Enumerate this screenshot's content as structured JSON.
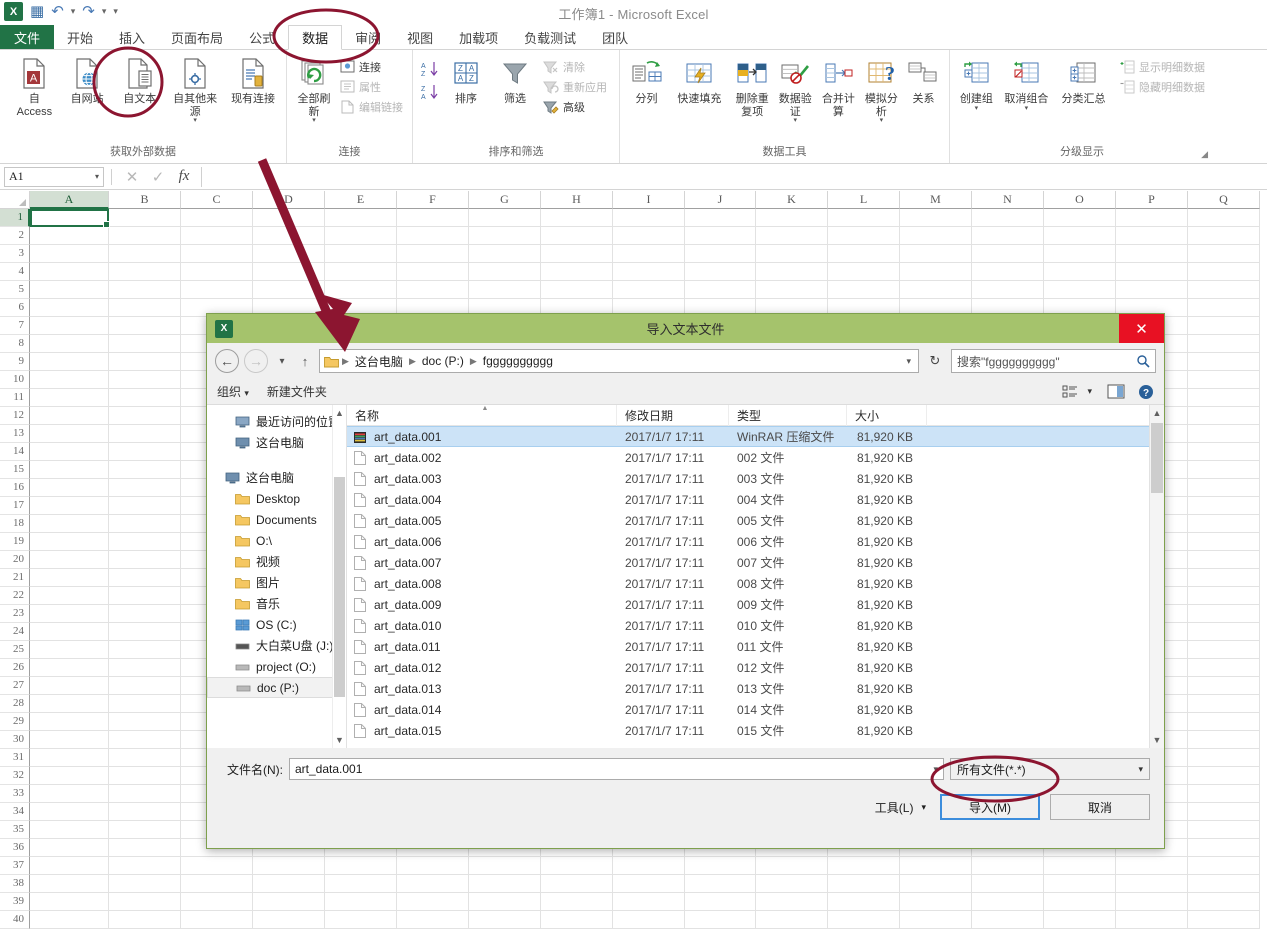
{
  "app": {
    "window_title": "工作簿1 - Microsoft Excel",
    "logo_text": "X",
    "qat": [
      {
        "name": "save",
        "glyph": "▤"
      },
      {
        "name": "undo",
        "glyph": "↶"
      },
      {
        "name": "redo",
        "glyph": "↷"
      },
      {
        "name": "customize",
        "glyph": "▾"
      }
    ]
  },
  "ribbon": {
    "tabs": [
      {
        "label": "文件",
        "kind": "file"
      },
      {
        "label": "开始",
        "kind": "normal"
      },
      {
        "label": "插入",
        "kind": "normal"
      },
      {
        "label": "页面布局",
        "kind": "normal"
      },
      {
        "label": "公式",
        "kind": "normal"
      },
      {
        "label": "数据",
        "kind": "active"
      },
      {
        "label": "审阅",
        "kind": "normal"
      },
      {
        "label": "视图",
        "kind": "normal"
      },
      {
        "label": "加载项",
        "kind": "normal"
      },
      {
        "label": "负载测试",
        "kind": "normal"
      },
      {
        "label": "团队",
        "kind": "normal"
      }
    ],
    "groups": [
      {
        "label": "获取外部数据",
        "big": [
          {
            "label": "自 Access",
            "icon": "from-access-icon"
          },
          {
            "label": "自网站",
            "icon": "from-web-icon"
          },
          {
            "label": "自文本",
            "icon": "from-text-icon"
          },
          {
            "label": "自其他来源",
            "icon": "from-other-sources-icon",
            "caret": true
          },
          {
            "label": "现有连接",
            "icon": "existing-connections-icon"
          }
        ]
      },
      {
        "label": "连接",
        "big": [
          {
            "label": "全部刷新",
            "icon": "refresh-all-icon",
            "caret": true
          }
        ],
        "small": [
          {
            "label": "连接",
            "icon": "connections-icon",
            "dim": false
          },
          {
            "label": "属性",
            "icon": "properties-icon",
            "dim": true
          },
          {
            "label": "编辑链接",
            "icon": "edit-links-icon",
            "dim": true
          }
        ]
      },
      {
        "label": "排序和筛选",
        "big": [
          {
            "label": "排序",
            "icon": "sort-icon"
          },
          {
            "label": "筛选",
            "icon": "filter-icon"
          }
        ],
        "sortmini": [
          {
            "label": "升序",
            "icon": "sort-asc-icon"
          },
          {
            "label": "降序",
            "icon": "sort-desc-icon"
          }
        ],
        "small": [
          {
            "label": "清除",
            "icon": "clear-filter-icon",
            "dim": true
          },
          {
            "label": "重新应用",
            "icon": "reapply-icon",
            "dim": true
          },
          {
            "label": "高级",
            "icon": "advanced-filter-icon",
            "dim": false
          }
        ]
      },
      {
        "label": "数据工具",
        "big": [
          {
            "label": "分列",
            "icon": "text-to-columns-icon"
          },
          {
            "label": "快速填充",
            "icon": "flash-fill-icon"
          },
          {
            "label": "删除重复项",
            "icon": "remove-duplicates-icon"
          },
          {
            "label": "数据验证",
            "icon": "data-validation-icon",
            "caret": true
          },
          {
            "label": "合并计算",
            "icon": "consolidate-icon"
          },
          {
            "label": "模拟分析",
            "icon": "what-if-analysis-icon",
            "caret": true
          },
          {
            "label": "关系",
            "icon": "relationships-icon"
          }
        ]
      },
      {
        "label": "分级显示",
        "dialog_launcher": true,
        "big": [
          {
            "label": "创建组",
            "icon": "group-icon",
            "caret": true
          },
          {
            "label": "取消组合",
            "icon": "ungroup-icon",
            "caret": true
          },
          {
            "label": "分类汇总",
            "icon": "subtotal-icon"
          }
        ],
        "small": [
          {
            "label": "显示明细数据",
            "icon": "show-detail-icon",
            "dim": true
          },
          {
            "label": "隐藏明细数据",
            "icon": "hide-detail-icon",
            "dim": true
          }
        ]
      }
    ]
  },
  "formula_bar": {
    "name_box": "A1",
    "cancel_icon": "cancel-icon",
    "enter_icon": "enter-icon",
    "fx_icon": "insert-function-icon",
    "value": ""
  },
  "grid": {
    "columns": [
      "A",
      "B",
      "C",
      "D",
      "E",
      "F",
      "G",
      "H",
      "I",
      "J",
      "K",
      "L",
      "M",
      "N",
      "O",
      "P",
      "Q"
    ],
    "rows": [
      1,
      2,
      3,
      4,
      5,
      6,
      7,
      8,
      9,
      10,
      11,
      12,
      13,
      14,
      15,
      16,
      17,
      18,
      19,
      20,
      21,
      22,
      23,
      24,
      25,
      26,
      27,
      28,
      29,
      30,
      31,
      32,
      33,
      34,
      35,
      36,
      37,
      38,
      39,
      40
    ],
    "selected_cell": "A1"
  },
  "dialog": {
    "title": "导入文本文件",
    "icon": "excel-icon",
    "close_label": "✕",
    "nav": {
      "back_icon": "back-arrow-icon",
      "forward_icon": "forward-arrow-icon",
      "recent_icon": "recent-dropdown-icon",
      "up_icon": "up-arrow-icon",
      "breadcrumbs": [
        "这台电脑",
        "doc (P:)",
        "fgggggggggg"
      ],
      "refresh_icon": "refresh-icon",
      "search_placeholder": "搜索\"fgggggggggg\"",
      "search_icon": "search-icon"
    },
    "toolbar": {
      "organize": "组织",
      "new_folder": "新建文件夹",
      "view_icon": "view-layout-icon",
      "view_caret": "▾",
      "preview_icon": "preview-pane-icon",
      "help_icon": "help-icon"
    },
    "nav_pane": {
      "top": [
        {
          "label": "最近访问的位置",
          "icon": "recent-places-icon"
        },
        {
          "label": "这台电脑",
          "icon": "this-pc-icon"
        }
      ],
      "tree": [
        {
          "label": "这台电脑",
          "icon": "this-pc-icon",
          "indent": false
        },
        {
          "label": "Desktop",
          "icon": "desktop-folder-icon",
          "indent": true
        },
        {
          "label": "Documents",
          "icon": "documents-folder-icon",
          "indent": true
        },
        {
          "label": "O:\\",
          "icon": "drive-folder-icon",
          "indent": true
        },
        {
          "label": "视频",
          "icon": "videos-folder-icon",
          "indent": true
        },
        {
          "label": "图片",
          "icon": "pictures-folder-icon",
          "indent": true
        },
        {
          "label": "音乐",
          "icon": "music-folder-icon",
          "indent": true
        },
        {
          "label": "OS (C:)",
          "icon": "windows-drive-icon",
          "indent": true
        },
        {
          "label": "大白菜U盘 (J:)",
          "icon": "usb-drive-icon",
          "indent": true
        },
        {
          "label": "project (O:)",
          "icon": "network-drive-icon",
          "indent": true
        },
        {
          "label": "doc (P:)",
          "icon": "network-drive-icon",
          "indent": true,
          "selected": true
        }
      ]
    },
    "file_list": {
      "columns": [
        "名称",
        "修改日期",
        "类型",
        "大小"
      ],
      "sort_column": "名称",
      "rows": [
        {
          "name": "art_data.001",
          "date": "2017/1/7 17:11",
          "type": "WinRAR 压缩文件",
          "size": "81,920 KB",
          "icon": "winrar-icon",
          "selected": true
        },
        {
          "name": "art_data.002",
          "date": "2017/1/7 17:11",
          "type": "002 文件",
          "size": "81,920 KB",
          "icon": "generic-file-icon",
          "selected": false
        },
        {
          "name": "art_data.003",
          "date": "2017/1/7 17:11",
          "type": "003 文件",
          "size": "81,920 KB",
          "icon": "generic-file-icon",
          "selected": false
        },
        {
          "name": "art_data.004",
          "date": "2017/1/7 17:11",
          "type": "004 文件",
          "size": "81,920 KB",
          "icon": "generic-file-icon",
          "selected": false
        },
        {
          "name": "art_data.005",
          "date": "2017/1/7 17:11",
          "type": "005 文件",
          "size": "81,920 KB",
          "icon": "generic-file-icon",
          "selected": false
        },
        {
          "name": "art_data.006",
          "date": "2017/1/7 17:11",
          "type": "006 文件",
          "size": "81,920 KB",
          "icon": "generic-file-icon",
          "selected": false
        },
        {
          "name": "art_data.007",
          "date": "2017/1/7 17:11",
          "type": "007 文件",
          "size": "81,920 KB",
          "icon": "generic-file-icon",
          "selected": false
        },
        {
          "name": "art_data.008",
          "date": "2017/1/7 17:11",
          "type": "008 文件",
          "size": "81,920 KB",
          "icon": "generic-file-icon",
          "selected": false
        },
        {
          "name": "art_data.009",
          "date": "2017/1/7 17:11",
          "type": "009 文件",
          "size": "81,920 KB",
          "icon": "generic-file-icon",
          "selected": false
        },
        {
          "name": "art_data.010",
          "date": "2017/1/7 17:11",
          "type": "010 文件",
          "size": "81,920 KB",
          "icon": "generic-file-icon",
          "selected": false
        },
        {
          "name": "art_data.011",
          "date": "2017/1/7 17:11",
          "type": "011 文件",
          "size": "81,920 KB",
          "icon": "generic-file-icon",
          "selected": false
        },
        {
          "name": "art_data.012",
          "date": "2017/1/7 17:11",
          "type": "012 文件",
          "size": "81,920 KB",
          "icon": "generic-file-icon",
          "selected": false
        },
        {
          "name": "art_data.013",
          "date": "2017/1/7 17:11",
          "type": "013 文件",
          "size": "81,920 KB",
          "icon": "generic-file-icon",
          "selected": false
        },
        {
          "name": "art_data.014",
          "date": "2017/1/7 17:11",
          "type": "014 文件",
          "size": "81,920 KB",
          "icon": "generic-file-icon",
          "selected": false
        },
        {
          "name": "art_data.015",
          "date": "2017/1/7 17:11",
          "type": "015 文件",
          "size": "81,920 KB",
          "icon": "generic-file-icon",
          "selected": false
        }
      ]
    },
    "bottom": {
      "filename_label": "文件名(N):",
      "filename_value": "art_data.001",
      "filter_value": "所有文件(*.*)",
      "tools_label": "工具(L)",
      "import_label": "导入(M)",
      "cancel_label": "取消"
    }
  },
  "annotations": {
    "accent_color": "#8c1530",
    "arrow_color": "#8c1530",
    "circles": [
      "data-tab-circle",
      "from-text-circle",
      "file-filter-circle"
    ],
    "arrow": "pointer-to-dialog"
  }
}
